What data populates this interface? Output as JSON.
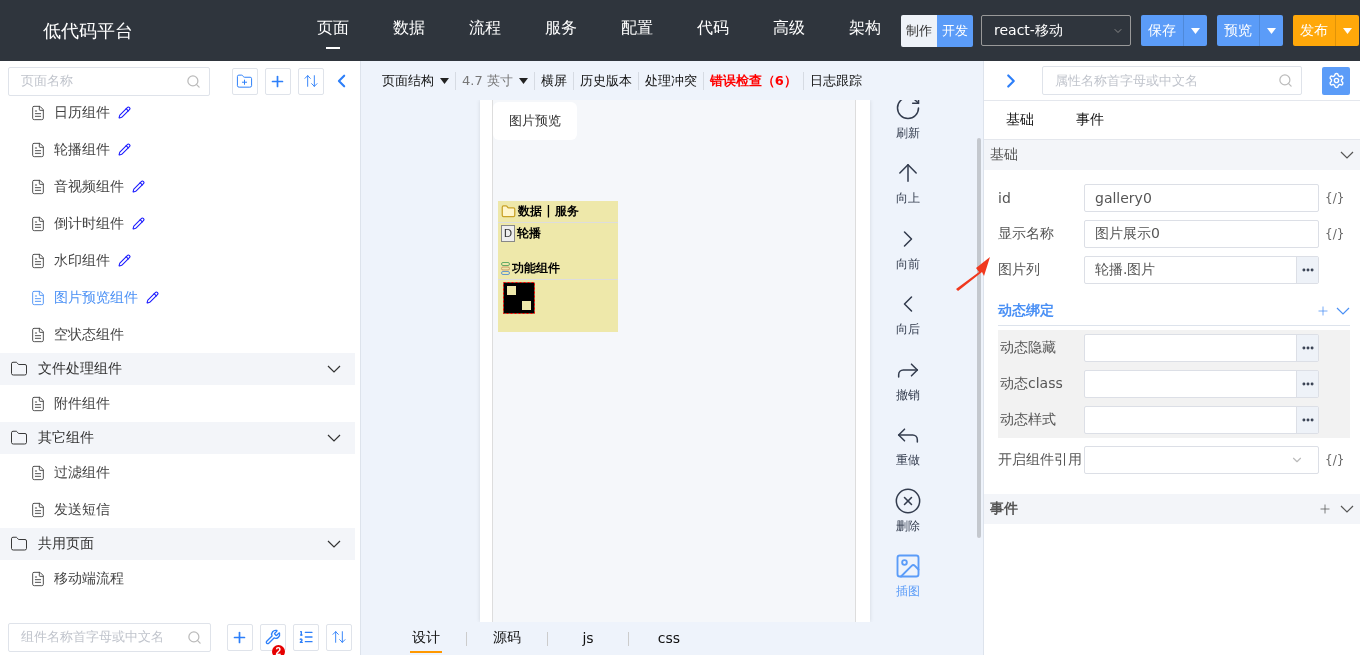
{
  "header": {
    "logo": "低代码平台",
    "nav": [
      {
        "label": "页面",
        "selected": true
      },
      {
        "label": "数据",
        "selected": false
      },
      {
        "label": "流程",
        "selected": false
      },
      {
        "label": "服务",
        "selected": false
      },
      {
        "label": "配置",
        "selected": false
      },
      {
        "label": "代码",
        "selected": false
      },
      {
        "label": "高级",
        "selected": false
      },
      {
        "label": "架构",
        "selected": false
      }
    ],
    "mode_toggle": [
      {
        "label": "制作",
        "selected": false
      },
      {
        "label": "开发",
        "selected": true
      }
    ],
    "framework_select": {
      "value": "react-移动"
    },
    "actions": [
      {
        "label": "保存",
        "kind": "primary"
      },
      {
        "label": "预览",
        "kind": "primary"
      },
      {
        "label": "发布",
        "kind": "warning"
      }
    ]
  },
  "sidebar": {
    "search": {
      "placeholder": "页面名称"
    },
    "items": [
      {
        "kind": "page",
        "label": "日历组件",
        "editable": true,
        "selected": false
      },
      {
        "kind": "page",
        "label": "轮播组件",
        "editable": true,
        "selected": false
      },
      {
        "kind": "page",
        "label": "音视频组件",
        "editable": true,
        "selected": false
      },
      {
        "kind": "page",
        "label": "倒计时组件",
        "editable": true,
        "selected": false
      },
      {
        "kind": "page",
        "label": "水印组件",
        "editable": true,
        "selected": false
      },
      {
        "kind": "page",
        "label": "图片预览组件",
        "editable": true,
        "selected": true
      },
      {
        "kind": "page",
        "label": "空状态组件",
        "editable": false,
        "selected": false
      },
      {
        "kind": "folder",
        "label": "文件处理组件",
        "expanded": true,
        "children": [
          {
            "kind": "page",
            "label": "附件组件",
            "editable": false,
            "selected": false
          }
        ]
      },
      {
        "kind": "folder",
        "label": "其它组件",
        "expanded": true,
        "children": [
          {
            "kind": "page",
            "label": "过滤组件",
            "editable": false,
            "selected": false
          },
          {
            "kind": "page",
            "label": "发送短信",
            "editable": false,
            "selected": false
          }
        ]
      },
      {
        "kind": "folder",
        "label": "共用页面",
        "expanded": true,
        "children": [
          {
            "kind": "page",
            "label": "移动端流程",
            "editable": false,
            "selected": false
          }
        ]
      }
    ],
    "component_search": {
      "placeholder": "组件名称首字母或中文名"
    },
    "tools_badge": "2"
  },
  "toolbar": [
    {
      "label": "页面结构",
      "kind": "menu"
    },
    {
      "label": "4.7 英寸",
      "kind": "select"
    },
    {
      "label": "横屏",
      "kind": "action"
    },
    {
      "label": "历史版本",
      "kind": "action"
    },
    {
      "label": "处理冲突",
      "kind": "action"
    },
    {
      "label": "错误检查（6）",
      "kind": "alert"
    },
    {
      "label": "日志跟踪",
      "kind": "action"
    }
  ],
  "canvas": {
    "chip": "图片预览",
    "component_box": {
      "group": "数据 | 服务",
      "item_icon": "D",
      "item": "轮播",
      "section": "功能组件"
    }
  },
  "tools": [
    {
      "label": "刷新",
      "kind": "refresh",
      "selected": false
    },
    {
      "label": "向上",
      "kind": "up",
      "selected": false
    },
    {
      "label": "向前",
      "kind": "forward",
      "selected": false
    },
    {
      "label": "向后",
      "kind": "back",
      "selected": false
    },
    {
      "label": "撤销",
      "kind": "undo",
      "selected": false
    },
    {
      "label": "重做",
      "kind": "redo",
      "selected": false
    },
    {
      "label": "删除",
      "kind": "delete",
      "selected": false
    },
    {
      "label": "插图",
      "kind": "image",
      "selected": true
    }
  ],
  "editor_tabs": [
    {
      "label": "设计",
      "selected": true
    },
    {
      "label": "源码",
      "selected": false
    },
    {
      "label": "js",
      "selected": false
    },
    {
      "label": "css",
      "selected": false
    }
  ],
  "properties": {
    "search": {
      "placeholder": "属性名称首字母或中文名"
    },
    "tabs": [
      "基础",
      "事件"
    ],
    "basic": {
      "title": "基础",
      "expanded": true,
      "fields": [
        {
          "label": "id",
          "value": "gallery0",
          "kind": "expr",
          "suffix": "{/}"
        },
        {
          "label": "显示名称",
          "value": "图片展示0",
          "kind": "expr",
          "suffix": "{/}"
        },
        {
          "label": "图片列",
          "value": "轮播.图片",
          "kind": "picker"
        }
      ],
      "binding": {
        "title": "动态绑定",
        "expanded": true,
        "fields": [
          {
            "label": "动态隐藏",
            "kind": "picker"
          },
          {
            "label": "动态class",
            "kind": "picker"
          },
          {
            "label": "动态样式",
            "kind": "picker"
          }
        ]
      },
      "extra_fields": [
        {
          "label": "开启组件引用",
          "kind": "select",
          "suffix": "{/}"
        }
      ]
    },
    "events": {
      "title": "事件",
      "expanded": true
    }
  }
}
